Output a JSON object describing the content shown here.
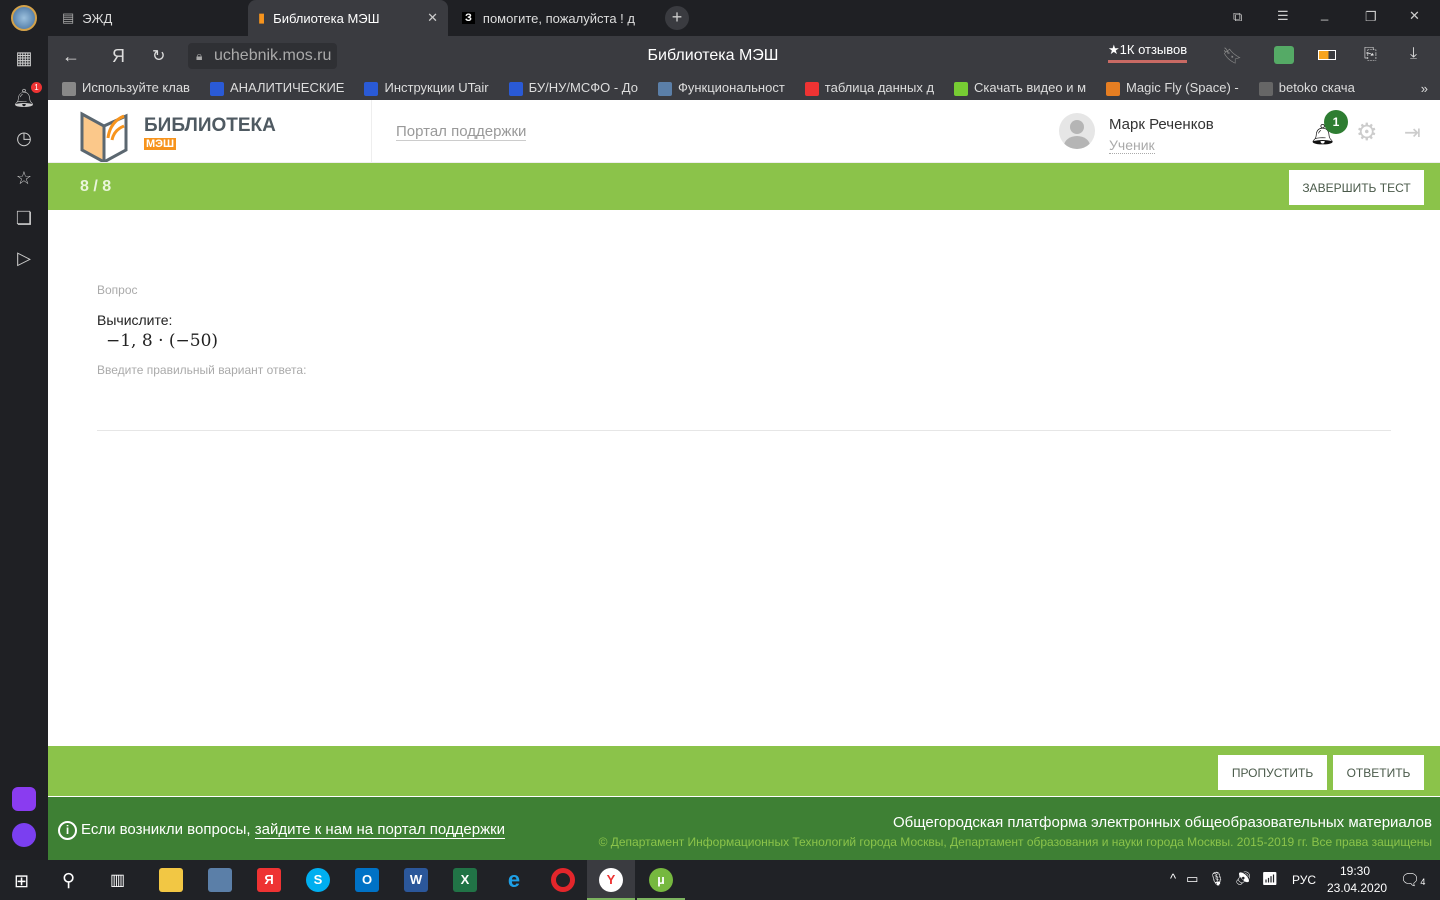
{
  "browser": {
    "tabs": [
      {
        "label": "ЭЖД"
      },
      {
        "label": "Библиотека МЭШ"
      },
      {
        "label": "помогите, пожалуйста ! д"
      }
    ],
    "url": "uchebnik.mos.ru",
    "page_title": "Библиотека МЭШ",
    "reviews": "★1К отзывов",
    "notification_count": "1",
    "bookmarks": [
      "Используйте клав",
      "АНАЛИТИЧЕСКИЕ",
      "Инструкции UTair",
      "БУ/НУ/МСФО - До",
      "Функциональност",
      "таблица данных д",
      "Скачать видео и м",
      "Magic Fly (Space) -",
      "betoko скача"
    ]
  },
  "header": {
    "logo_title": "БИБЛИОТЕКА",
    "logo_sub": "МЭШ",
    "support_link": "Портал поддержки",
    "user_name": "Марк Реченков",
    "user_role": "Ученик",
    "notif_badge": "1"
  },
  "progress": {
    "counter": "8 / 8",
    "finish_label": "ЗАВЕРШИТЬ ТЕСТ"
  },
  "question": {
    "label": "Вопрос",
    "prompt": "Вычислите:",
    "expression": "−1, 8 · (−50)",
    "answer_hint": "Введите правильный вариант ответа:",
    "answer_value": ""
  },
  "actions": {
    "skip": "ПРОПУСТИТЬ",
    "answer": "ОТВЕТИТЬ"
  },
  "footer": {
    "help_text": "Если возникли вопросы,",
    "help_link": "зайдите к нам на портал поддержки",
    "platform": "Общегородская платформа электронных общеобразовательных материалов",
    "copyright": "© Департамент Информационных Технологий города Москвы, Департамент образования и науки города Москвы. 2015-2019 гг. Все права защищены"
  },
  "taskbar": {
    "time": "19:30",
    "date": "23.04.2020",
    "lang": "РУС",
    "notif": "4"
  },
  "colors": {
    "green": "#8bc34a",
    "dark_green": "#3e8034",
    "orange": "#f7941d"
  }
}
